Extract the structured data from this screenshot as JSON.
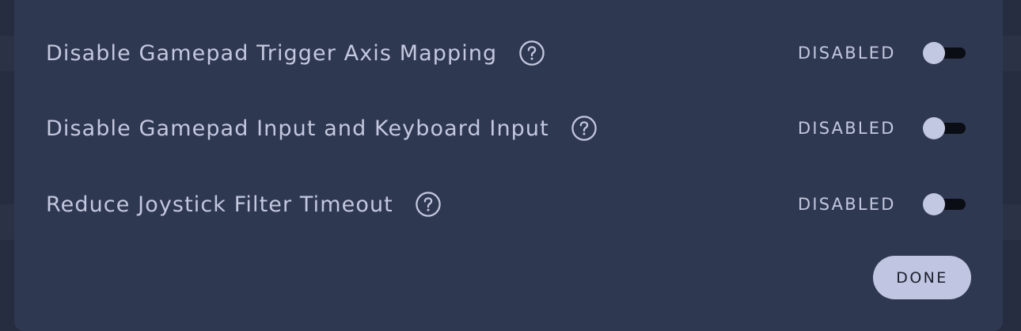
{
  "settings": [
    {
      "label": "Disable Gamepad Trigger Axis Mapping",
      "state": "DISABLED",
      "help_icon": "question-circle-icon",
      "enabled": false
    },
    {
      "label": "Disable Gamepad Input and Keyboard Input",
      "state": "DISABLED",
      "help_icon": "question-circle-icon",
      "enabled": false
    },
    {
      "label": "Reduce Joystick Filter Timeout",
      "state": "DISABLED",
      "help_icon": "question-circle-icon",
      "enabled": false
    }
  ],
  "footer": {
    "done_label": "DONE"
  },
  "colors": {
    "dialog_background": "#2f3851",
    "text": "#c3c8de",
    "toggle_knob": "#c3c8e2",
    "toggle_track": "#0b0d14",
    "done_button": "#c0c6e1"
  }
}
